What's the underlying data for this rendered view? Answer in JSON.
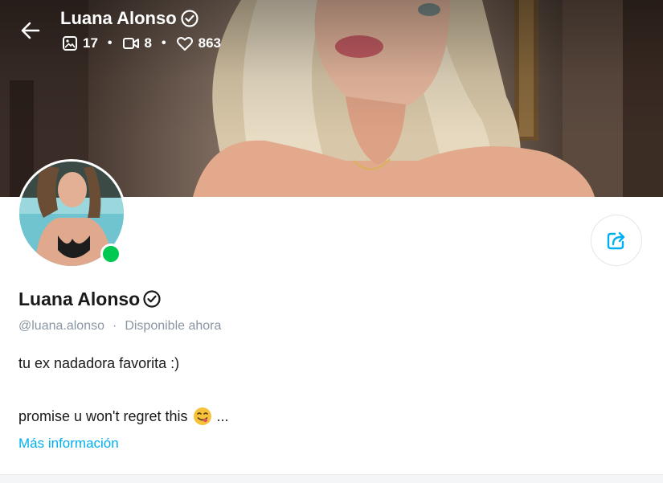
{
  "header": {
    "name": "Luana Alonso",
    "stats": {
      "photos": "17",
      "videos": "8",
      "likes": "863"
    }
  },
  "profile": {
    "name": "Luana Alonso",
    "handle": "@luana.alonso",
    "separator": "·",
    "status": "Disponible ahora",
    "bio_line1": "tu ex nadadora favorita :)",
    "bio_line2": "promise u won't regret this",
    "bio_ellipsis": "...",
    "more_info": "Más información",
    "online": true
  },
  "icons": {
    "back": "arrow-left-icon",
    "verified": "verified-badge-icon",
    "photos": "image-icon",
    "videos": "video-icon",
    "likes": "heart-icon",
    "share": "share-icon",
    "emoji": "face-savoring-food-icon"
  },
  "colors": {
    "accent": "#00aff0",
    "muted": "#8a96a3",
    "online": "#00c851"
  }
}
